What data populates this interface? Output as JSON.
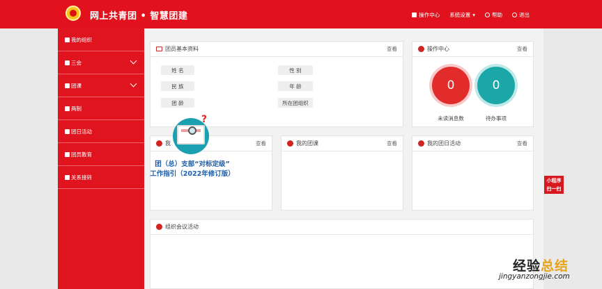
{
  "header": {
    "brand": "网上共青团 • 智慧团建",
    "nav": [
      {
        "label": "操作中心"
      },
      {
        "label": "系统设置"
      },
      {
        "label": "帮助"
      },
      {
        "label": "退出"
      }
    ]
  },
  "sidebar": {
    "items": [
      {
        "label": "我的组织"
      },
      {
        "label": "三会"
      },
      {
        "label": "团课"
      },
      {
        "label": "两制"
      },
      {
        "label": "团日活动"
      },
      {
        "label": "团员教育"
      },
      {
        "label": "关系接转"
      }
    ]
  },
  "member_card": {
    "title": "团员基本资料",
    "more": "查看",
    "fields": [
      "姓 名",
      "性 别",
      "民 族",
      "年 龄",
      "团 龄",
      "所在团组织"
    ]
  },
  "ops_card": {
    "title": "操作中心",
    "more": "查看",
    "unread_count": "0",
    "unread_label": "未读消息数",
    "todo_count": "0",
    "todo_label": "待办事项"
  },
  "row2": [
    {
      "title": "我",
      "more": "查看"
    },
    {
      "title": "我的团课",
      "more": "查看"
    },
    {
      "title": "我的团日活动",
      "more": "查看"
    }
  ],
  "meetings_card": {
    "title": "组织会议活动"
  },
  "overlay": {
    "banner_line1": "团（总）支部“对标定级”",
    "banner_line2": "工作指引（2022年修订版）",
    "qmark": "?",
    "mini_line1": "小程序",
    "mini_line2": "扫一扫"
  },
  "watermark": {
    "text_a": "经验",
    "text_b": "总结",
    "url": "jingyanzongjie.com"
  }
}
